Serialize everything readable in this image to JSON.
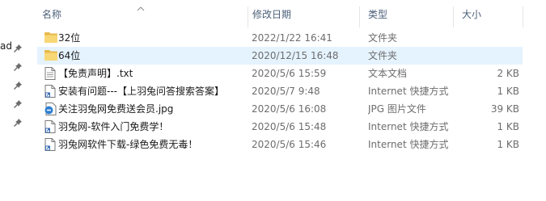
{
  "nav": {
    "partial_label": "ad",
    "pin_count": 5
  },
  "header": {
    "col_name": "名称",
    "col_date": "修改日期",
    "col_type": "类型",
    "col_size": "大小"
  },
  "files": [
    {
      "icon": "folder-icon",
      "name": "32位",
      "date": "2022/1/22 16:41",
      "type": "文件夹",
      "size": ""
    },
    {
      "icon": "folder-icon",
      "name": "64位",
      "date": "2020/12/15 16:48",
      "type": "文件夹",
      "size": ""
    },
    {
      "icon": "text-file-icon",
      "name": "【免责声明】.txt",
      "date": "2020/5/6 15:59",
      "type": "文本文档",
      "size": "2 KB"
    },
    {
      "icon": "shortcut-icon",
      "name": "安装有问题---【上羽兔问答搜索答案】",
      "date": "2020/5/7 9:48",
      "type": "Internet 快捷方式",
      "size": "1 KB"
    },
    {
      "icon": "jpg-image-icon",
      "name": "关注羽兔网免费送会员.jpg",
      "date": "2020/5/6 16:08",
      "type": "JPG 图片文件",
      "size": "39 KB"
    },
    {
      "icon": "shortcut-icon",
      "name": "羽兔网-软件入门免费学！",
      "date": "2020/5/6 15:48",
      "type": "Internet 快捷方式",
      "size": "1 KB"
    },
    {
      "icon": "shortcut-icon",
      "name": "羽兔网软件下载-绿色免费无毒！",
      "date": "2020/5/6 15:46",
      "type": "Internet 快捷方式",
      "size": "1 KB"
    }
  ],
  "colors": {
    "selection": "#e5f3ff",
    "header_text": "#4c607a",
    "folder": "#f8d775"
  }
}
